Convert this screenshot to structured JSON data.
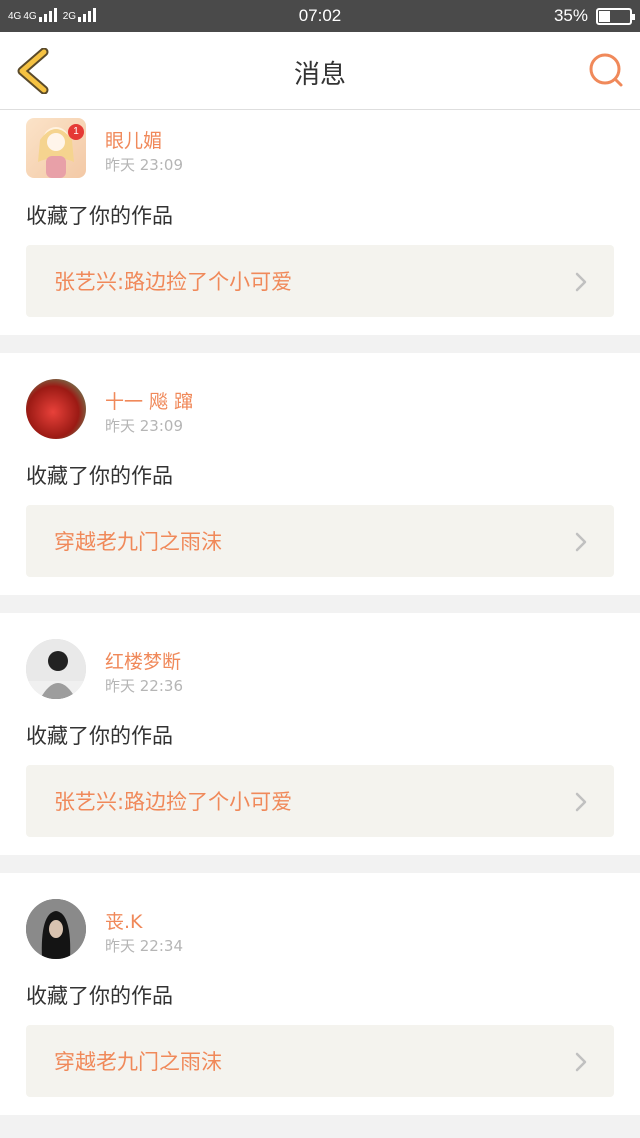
{
  "status_bar": {
    "network_1": "4G",
    "network_2": "4G",
    "network_3": "2G",
    "time": "07:02",
    "battery": "35%",
    "battery_level": 0.35
  },
  "header": {
    "title": "消息",
    "back_icon": "chevron-left-icon",
    "search_icon": "search-icon"
  },
  "colors": {
    "accent": "#f0895a",
    "back_arrow": "#f5c242",
    "badge": "#e53935"
  },
  "messages": [
    {
      "name": "眼儿媚",
      "time": "昨天 23:09",
      "action": "收藏了你的作品",
      "work": "张艺兴:路边捡了个小可爱",
      "badge": "1"
    },
    {
      "name": "十一 飚 蹿",
      "time": "昨天 23:09",
      "action": "收藏了你的作品",
      "work": "穿越老九门之雨沫"
    },
    {
      "name": "红楼梦断",
      "time": "昨天 22:36",
      "action": "收藏了你的作品",
      "work": "张艺兴:路边捡了个小可爱"
    },
    {
      "name": "丧.K",
      "time": "昨天 22:34",
      "action": "收藏了你的作品",
      "work": "穿越老九门之雨沫"
    }
  ]
}
